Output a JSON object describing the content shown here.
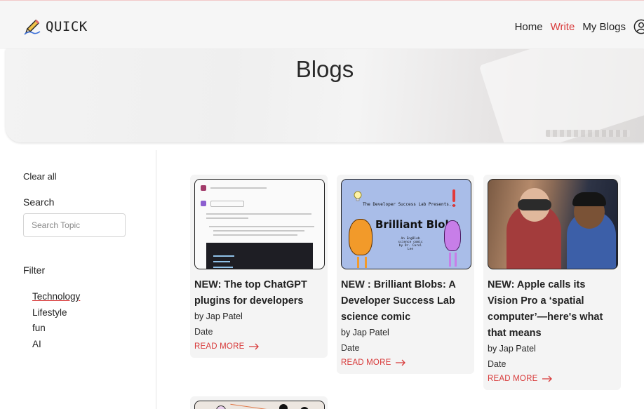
{
  "header": {
    "brand": "QUICK",
    "nav": [
      {
        "label": "Home",
        "active": false
      },
      {
        "label": "Write",
        "active": true
      },
      {
        "label": "My Blogs",
        "active": false
      }
    ],
    "accent_color": "#d83a3a"
  },
  "hero": {
    "title": "Blogs"
  },
  "sidebar": {
    "clear_all": "Clear all",
    "search_title": "Search",
    "search_placeholder": "Search Topic",
    "filter_title": "Filter",
    "filters": [
      "Technology",
      "Lifestyle",
      "fun",
      "AI"
    ]
  },
  "cards": [
    {
      "title": "NEW: The top ChatGPT plugins for developers",
      "author": "by Jap Patel",
      "date": "Date",
      "read_more": "READ MORE"
    },
    {
      "title": "NEW : Brilliant Blobs: A Developer Success Lab science comic",
      "author": "by Jap Patel",
      "date": "Date",
      "read_more": "READ MORE",
      "thumb_small_title": "The Developer Success Lab Presents...",
      "thumb_big_title": "Brilliant Blobs",
      "thumb_sub": "An EngBlob science comic by Dr. Carol Lee"
    },
    {
      "title": "NEW: Apple calls its Vision Pro a ‘spatial computer’—here's what that means",
      "author": "by Jap Patel",
      "date": "Date",
      "read_more": "READ MORE"
    }
  ]
}
